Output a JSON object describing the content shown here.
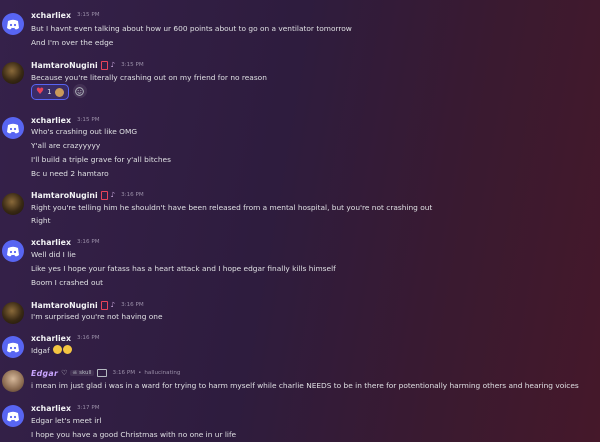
{
  "messages": [
    {
      "user": "xcharliex",
      "time": "3:15 PM",
      "avatar": "discord",
      "lines": [
        "But I havnt even talking about how ur 600 points about to go on a ventilator tomorrow",
        "And I'm over the edge"
      ]
    },
    {
      "user": "HamtaroNugini",
      "time": "3:15 PM",
      "avatar": "hamtaro",
      "lines": [
        "Because you're literally crashing out on my friend for no reason"
      ],
      "reaction": {
        "emoji": "heart",
        "count": "1"
      }
    },
    {
      "user": "xcharliex",
      "time": "3:15 PM",
      "avatar": "discord",
      "lines": [
        "Who's crashing out like OMG",
        "Y'all are crazyyyyy",
        "I'll build a triple grave for y'all bitches",
        "Bc u need 2 hamtaro"
      ]
    },
    {
      "user": "HamtaroNugini",
      "time": "3:16 PM",
      "avatar": "hamtaro",
      "lines": [
        "Right you're telling him he shouldn't have been released from a mental hospital, but you're not crashing out",
        "Right"
      ]
    },
    {
      "user": "xcharliex",
      "time": "3:16 PM",
      "avatar": "discord",
      "lines": [
        "Well did I lie",
        "Like yes I hope your fatass has a heart attack and I hope edgar finally kills himself",
        "Boom I crashed out"
      ]
    },
    {
      "user": "HamtaroNugini",
      "time": "3:16 PM",
      "avatar": "hamtaro",
      "lines": [
        "I'm surprised you're not having one"
      ]
    },
    {
      "user": "xcharliex",
      "time": "3:16 PM",
      "avatar": "discord",
      "lines": [
        "Idgaf"
      ]
    },
    {
      "user": "Edgar",
      "time": "3:16 PM",
      "avatar": "edgar",
      "tag": "skull",
      "status": "hallucinating",
      "lines": [
        "i mean im just glad i was in a ward for trying to harm myself while charlie NEEDS to be in there for potentionally harming others and hearing voices"
      ]
    },
    {
      "user": "xcharliex",
      "time": "3:17 PM",
      "avatar": "discord",
      "lines": [
        "Edgar let's meet irl",
        "I hope you have a good Christmas with no one in ur life"
      ]
    }
  ],
  "colors": {
    "discord_blurple": "#5865f2",
    "username": "#f2f3f5",
    "edgar_name": "#c9a6ff",
    "text": "#dfe0e3",
    "timestamp": "#9a8fa8",
    "badge_red": "#e8435a"
  }
}
